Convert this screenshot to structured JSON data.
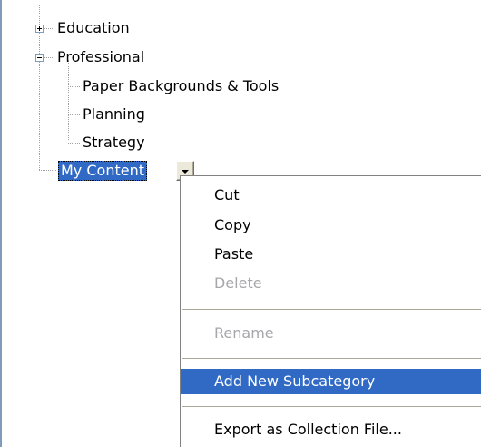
{
  "tree": {
    "nodes": [
      {
        "label": "Education",
        "expander": "collapsed"
      },
      {
        "label": "Professional",
        "expander": "expanded"
      },
      {
        "label": "Paper Backgrounds & Tools"
      },
      {
        "label": "Planning"
      },
      {
        "label": "Strategy"
      }
    ],
    "selected": {
      "label": "My Content"
    }
  },
  "context_menu": {
    "items": [
      {
        "label": "Cut",
        "enabled": true
      },
      {
        "label": "Copy",
        "enabled": true
      },
      {
        "label": "Paste",
        "enabled": true
      },
      {
        "label": "Delete",
        "enabled": false
      },
      {
        "label": "Rename",
        "enabled": false
      },
      {
        "label": "Add New Subcategory",
        "enabled": true,
        "highlighted": true
      },
      {
        "label": "Export as Collection File...",
        "enabled": true
      }
    ]
  },
  "colors": {
    "selection": "#316ac5",
    "border": "#7f9db9",
    "disabled_text": "#a7a6aa"
  }
}
